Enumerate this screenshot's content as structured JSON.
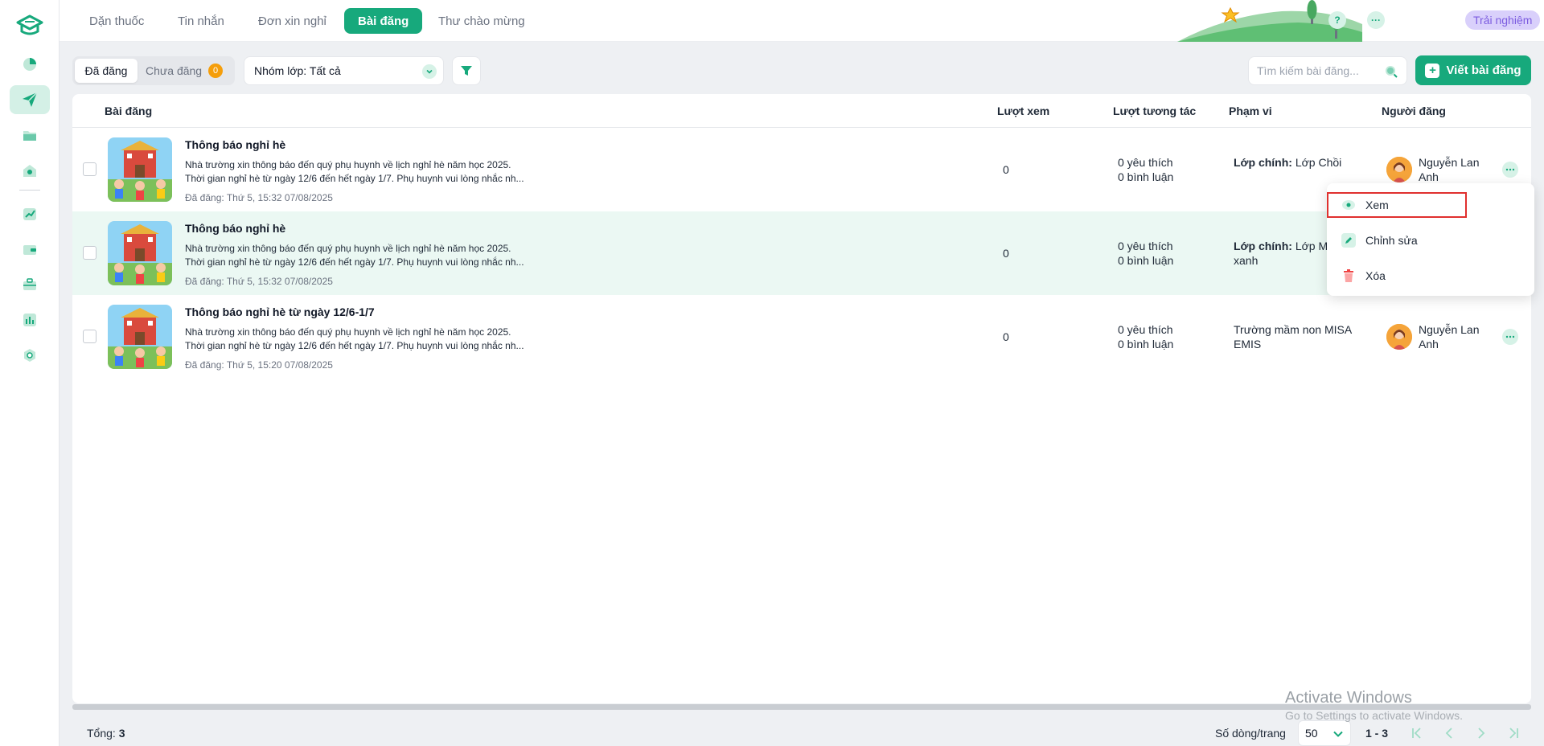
{
  "topbar": {
    "tabs": [
      {
        "label": "Dặn thuốc"
      },
      {
        "label": "Tin nhắn"
      },
      {
        "label": "Đơn xin nghỉ"
      },
      {
        "label": "Bài đăng",
        "active": true
      },
      {
        "label": "Thư chào mừng"
      }
    ],
    "help_label": "?",
    "more_label": "···",
    "trial_label": "Trải nghiệm"
  },
  "sidebar": {
    "items": [
      {
        "icon": "pie-chart-icon"
      },
      {
        "icon": "send-icon",
        "active": true
      },
      {
        "icon": "folder-icon"
      },
      {
        "icon": "home-heart-icon"
      },
      {
        "icon": "trend-chart-icon"
      },
      {
        "icon": "wallet-icon"
      },
      {
        "icon": "briefcase-icon"
      },
      {
        "icon": "bar-chart-icon"
      },
      {
        "icon": "settings-icon"
      }
    ]
  },
  "toolbar": {
    "published_label": "Đã đăng",
    "unpublished_label": "Chưa đăng",
    "unpublished_count": "0",
    "group_select_value": "Nhóm lớp: Tất cả",
    "search_placeholder": "Tìm kiếm bài đăng...",
    "write_label": "Viết bài đăng"
  },
  "table": {
    "columns": [
      "Bài đăng",
      "Lượt xem",
      "Lượt tương tác",
      "Phạm vi",
      "Người đăng"
    ],
    "rows": [
      {
        "title": "Thông báo nghỉ hè",
        "line1": "Nhà trường xin thông báo đến quý phụ huynh về lịch nghỉ hè năm học 2025.",
        "line2": "Thời gian nghỉ hè từ ngày 12/6 đến hết ngày 1/7. Phụ huynh vui lòng nhắc nh...",
        "date": "Đã đăng: Thứ 5, 15:32 07/08/2025",
        "views": "0",
        "likes": "0 yêu thích",
        "comments": "0 bình luận",
        "scope_label": "Lớp chính:",
        "scope_value": "Lớp Chồi",
        "poster": "Nguyễn Lan Anh"
      },
      {
        "title": "Thông báo nghỉ hè",
        "line1": "Nhà trường xin thông báo đến quý phụ huynh về lịch nghỉ hè năm học 2025.",
        "line2": "Thời gian nghỉ hè từ ngày 12/6 đến hết ngày 1/7. Phụ huynh vui lòng nhắc nh...",
        "date": "Đã đăng: Thứ 5, 15:32 07/08/2025",
        "views": "0",
        "likes": "0 yêu thích",
        "comments": "0 bình luận",
        "scope_label": "Lớp chính:",
        "scope_value": "Lớp M xanh",
        "poster": ""
      },
      {
        "title": "Thông báo nghỉ hè từ ngày 12/6-1/7",
        "line1": "Nhà trường xin thông báo đến quý phụ huynh về lịch nghỉ hè năm học 2025.",
        "line2": "Thời gian nghỉ hè từ ngày 12/6 đến hết ngày 1/7. Phụ huynh vui lòng nhắc nh...",
        "date": "Đã đăng: Thứ 5, 15:20 07/08/2025",
        "views": "0",
        "likes": "0 yêu thích",
        "comments": "0 bình luận",
        "scope_label": "",
        "scope_value": "Trường mầm non MISA EMIS",
        "poster": "Nguyễn Lan Anh"
      }
    ]
  },
  "context_menu": {
    "view_label": "Xem",
    "edit_label": "Chỉnh sửa",
    "delete_label": "Xóa"
  },
  "footer": {
    "total_label": "Tổng:",
    "total_value": "3",
    "rows_per_page_label": "Số dòng/trang",
    "rows_per_page_value": "50",
    "range": "1 - 3"
  },
  "watermark": {
    "title": "Activate Windows",
    "subtitle": "Go to Settings to activate Windows."
  },
  "colors": {
    "primary": "#17a97c",
    "primary_light": "#d6f2e7",
    "row_hover": "#ebf8f3",
    "badge": "#f59e0b",
    "trial_bg": "#d9d0fb",
    "trial_text": "#7c5ce0",
    "delete": "#ef4444",
    "highlight": "#e0302e"
  }
}
